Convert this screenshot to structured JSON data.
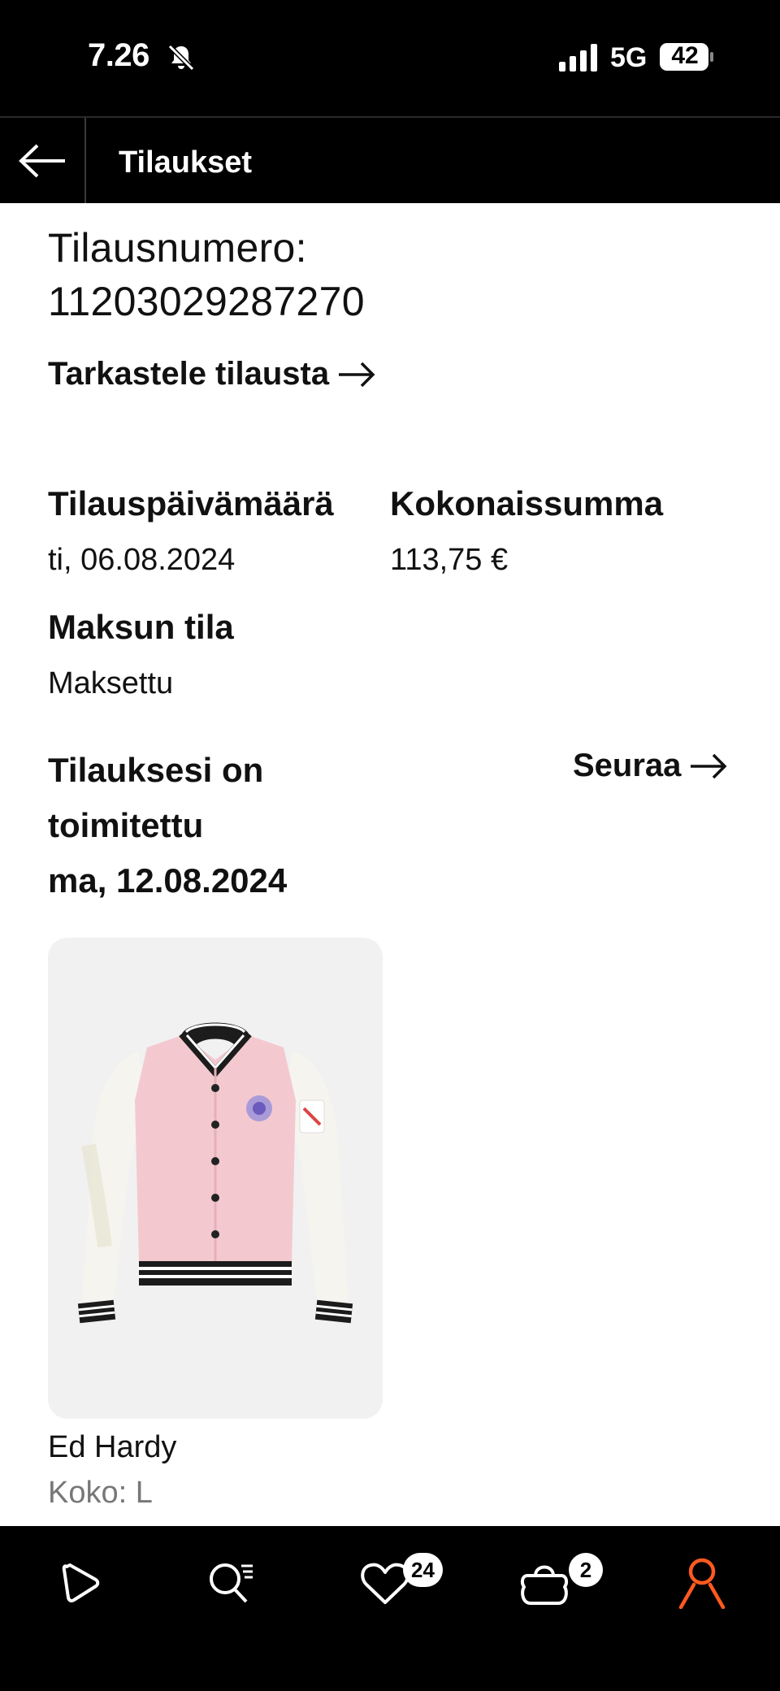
{
  "status_bar": {
    "time": "7.26",
    "network": "5G",
    "battery": "42",
    "icons": [
      "bell-muted-icon",
      "signal-icon",
      "battery-icon"
    ]
  },
  "nav": {
    "title": "Tilaukset",
    "back_icon": "arrow-left-icon"
  },
  "order": {
    "number_label": "Tilausnumero:",
    "number": "11203029287270",
    "view_link": "Tarkastele tilausta",
    "date_label": "Tilauspäivämäärä",
    "date_value": "ti, 06.08.2024",
    "total_label": "Kokonaissumma",
    "total_value": "113,75 €",
    "payment_label": "Maksun tila",
    "payment_value": "Maksettu",
    "delivery_line1": "Tilauksesi on",
    "delivery_line2": "toimitettu",
    "delivery_date": "ma, 12.08.2024",
    "follow_link": "Seuraa"
  },
  "product": {
    "brand": "Ed Hardy",
    "size": "Koko: L",
    "image": "pink-varsity-jacket"
  },
  "tab_bar": {
    "items": [
      {
        "icon": "play-icon"
      },
      {
        "icon": "search-icon"
      },
      {
        "icon": "heart-icon",
        "badge": "24"
      },
      {
        "icon": "bag-icon",
        "badge": "2"
      },
      {
        "icon": "profile-icon",
        "active": true
      }
    ],
    "accent_color": "#ff5a1f"
  }
}
